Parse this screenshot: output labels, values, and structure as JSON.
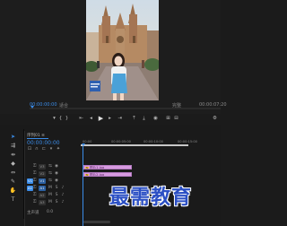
{
  "program_monitor": {
    "current_timecode": "00:00:00:00",
    "fit": "适合",
    "resolution": "完整",
    "duration": "00:00:07:20",
    "transport_controls": [
      "add-marker",
      "mark-in",
      "mark-out",
      "go-to-in",
      "step-back",
      "play",
      "step-forward",
      "go-to-out",
      "lift",
      "extract",
      "export-frame",
      "insert",
      "overwrite",
      "settings"
    ],
    "transport_glyphs": [
      "▾",
      "{",
      "}",
      "⇤",
      "◂",
      "▶",
      "▸",
      "⇥",
      "⤒",
      "⤓",
      "◉",
      "⊞",
      "⊟",
      "⚙"
    ]
  },
  "tools": [
    "selection-tool",
    "track-select-tool",
    "ripple-edit-tool",
    "razor-tool",
    "slip-tool",
    "pen-tool",
    "hand-tool",
    "type-tool"
  ],
  "tool_glyphs": [
    "➤",
    "⇶",
    "⇹",
    "◆",
    "⇔",
    "✎",
    "✋",
    "T"
  ],
  "timeline": {
    "sequence_tab": "序列01 ≡",
    "timecode": "00:00:00:00",
    "ruler_ticks": [
      "00:00",
      "00:00:05:00",
      "00:00:10:00",
      "00:00:15:00"
    ],
    "tracks": [
      {
        "name": "V3",
        "type": "video",
        "targeted": false
      },
      {
        "name": "V2",
        "type": "video",
        "targeted": false
      },
      {
        "name": "V1",
        "type": "video",
        "targeted": true,
        "source": "V1"
      },
      {
        "name": "A1",
        "type": "audio",
        "targeted": true,
        "source": "A1"
      },
      {
        "name": "A2",
        "type": "audio",
        "targeted": false
      },
      {
        "name": "A3",
        "type": "audio",
        "targeted": false
      }
    ],
    "clips": [
      {
        "track": "V3",
        "label": "图片1.jpg"
      },
      {
        "track": "V2",
        "label": "图片2.jpg"
      }
    ],
    "master": {
      "label": "主声道",
      "value": "0.0"
    }
  },
  "watermark": "最需教育",
  "colors": {
    "accent": "#3b8ce8",
    "clip": "#d79be0",
    "watermark": "#2b4fc4"
  }
}
